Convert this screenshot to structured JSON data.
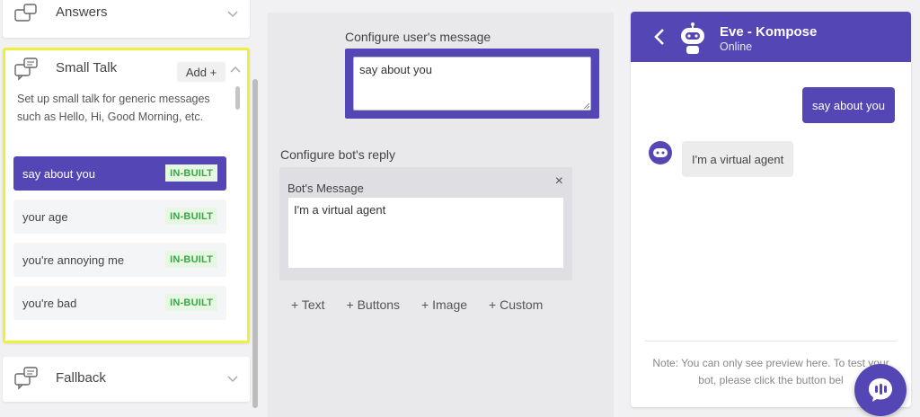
{
  "left_panel": {
    "answers_card": {
      "title": "Answers",
      "icon": "chat-bubbles-icon"
    },
    "small_talk": {
      "title": "Small Talk",
      "icon": "chat-bubbles-icon",
      "add_label": "Add +",
      "description": "Set up small talk for generic messages such as Hello, Hi, Good Morning, etc.",
      "items": [
        {
          "label": "say about you",
          "badge": "IN-BUILT",
          "active": true
        },
        {
          "label": "your age",
          "badge": "IN-BUILT",
          "active": false
        },
        {
          "label": "you're annoying me",
          "badge": "IN-BUILT",
          "active": false
        },
        {
          "label": "you're bad",
          "badge": "IN-BUILT",
          "active": false
        }
      ]
    },
    "fallback_card": {
      "title": "Fallback",
      "icon": "chat-bubbles-icon"
    }
  },
  "middle_panel": {
    "user_message_label": "Configure user's message",
    "user_message_value": "say about you",
    "bot_reply_label": "Configure bot's reply",
    "bot_message_title": "Bot's Message",
    "bot_message_value": "I'm a virtual agent",
    "add_options": [
      "+ Text",
      "+ Buttons",
      "+ Image",
      "+ Custom"
    ]
  },
  "chat_preview": {
    "bot_name": "Eve - Kompose",
    "status": "Online",
    "messages": {
      "user": "say about you",
      "bot": "I'm a virtual agent"
    },
    "note": "Note: You can only see preview here. To test your bot, please click the button bel"
  },
  "colors": {
    "accent": "#5546b5",
    "highlight_border": "#eef03a",
    "badge_text": "#3aa746",
    "badge_bg": "#e6f8e2"
  }
}
